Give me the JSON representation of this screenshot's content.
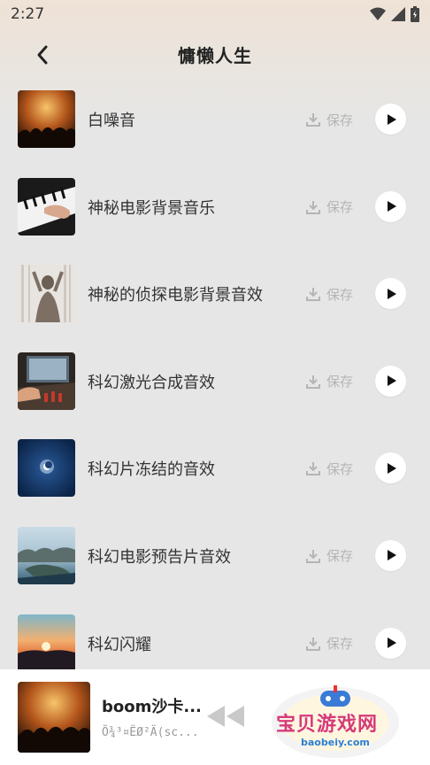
{
  "status_bar": {
    "time": "2:27"
  },
  "header": {
    "title": "慵懒人生",
    "back_icon": "chevron-left-icon"
  },
  "tracks": [
    {
      "title": "白噪音",
      "save_label": "保存"
    },
    {
      "title": "神秘电影背景音乐",
      "save_label": "保存"
    },
    {
      "title": "神秘的侦探电影背景音效",
      "save_label": "保存"
    },
    {
      "title": "科幻激光合成音效",
      "save_label": "保存"
    },
    {
      "title": "科幻片冻结的音效",
      "save_label": "保存"
    },
    {
      "title": "科幻电影预告片音效",
      "save_label": "保存"
    },
    {
      "title": "科幻闪耀",
      "save_label": "保存"
    }
  ],
  "player": {
    "title": "boom沙卡...",
    "subtitle": "Õ¾³¤ËØ²Ä(sc..."
  },
  "watermark": {
    "label": "宝贝游戏网",
    "url": "baobeiy.com"
  },
  "colors": {
    "background": "#e6e6e6",
    "save_text": "#b5b5b5",
    "watermark_pink": "#d63a7a",
    "watermark_blue": "#2b7fd3"
  }
}
